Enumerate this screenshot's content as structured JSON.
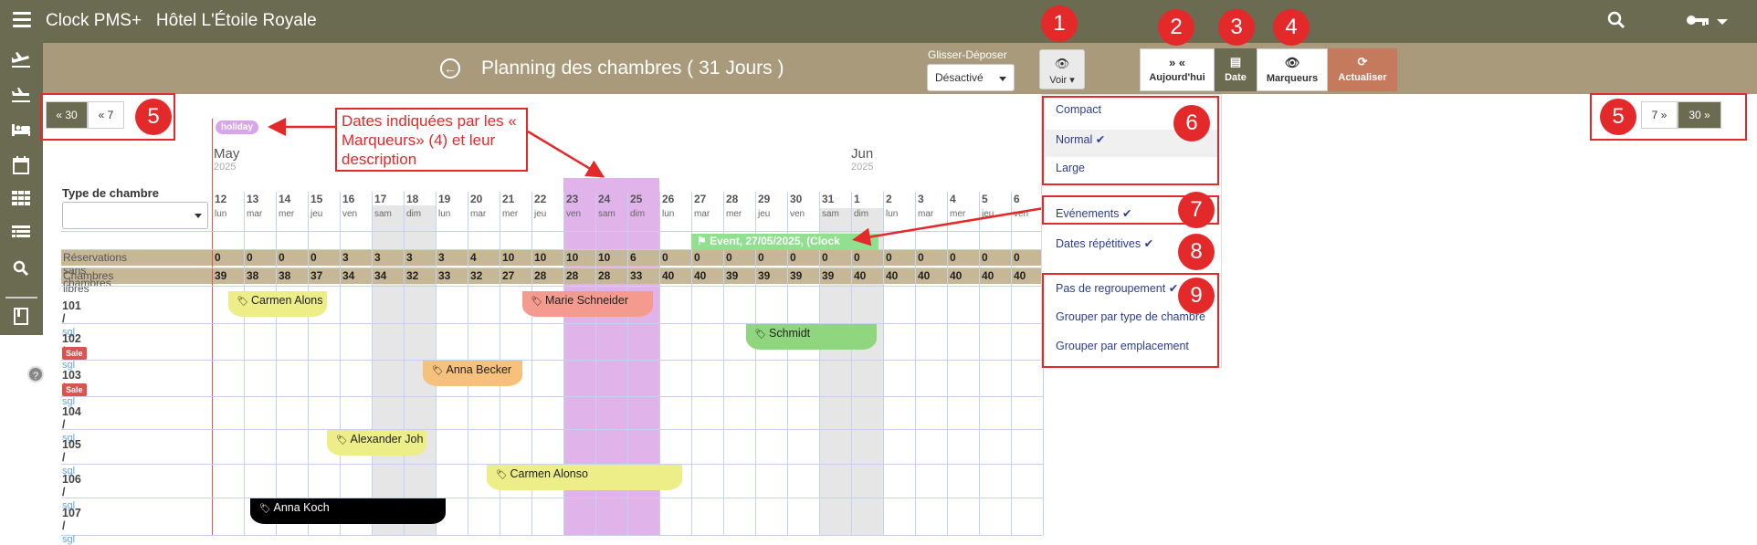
{
  "app": {
    "name": "Clock PMS+",
    "hotel": "Hôtel L'Étoile Royale"
  },
  "header": {
    "title": "Planning des chambres ( 31 Jours )"
  },
  "drag_drop": {
    "label": "Glisser-Déposer",
    "value": "Désactivé"
  },
  "toolbar": {
    "view_label": "Voir",
    "today_label": "Aujourd'hui",
    "date_label": "Date",
    "markers_label": "Marqueurs",
    "refresh_label": "Actualiser"
  },
  "nav": {
    "back30": "« 30",
    "back7": "« 7",
    "fwd7": "7 »",
    "fwd30": "30 »"
  },
  "annotations": {
    "n1": "1",
    "n2": "2",
    "n3": "3",
    "n4": "4",
    "n5a": "5",
    "n5b": "5",
    "n6": "6",
    "n7": "7",
    "n8": "8",
    "n9": "9",
    "callout": "Dates indiquées par les « Marqueurs» (4) et leur description"
  },
  "marker": {
    "holiday": "holiday"
  },
  "months": [
    {
      "name": "May",
      "year": "2025"
    },
    {
      "name": "Jun",
      "year": "2025"
    }
  ],
  "room_type": {
    "label": "Type de chambre",
    "value": ""
  },
  "days": [
    {
      "d": "12",
      "w": "lun"
    },
    {
      "d": "13",
      "w": "mar"
    },
    {
      "d": "14",
      "w": "mer"
    },
    {
      "d": "15",
      "w": "jeu"
    },
    {
      "d": "16",
      "w": "ven"
    },
    {
      "d": "17",
      "w": "sam"
    },
    {
      "d": "18",
      "w": "dim"
    },
    {
      "d": "19",
      "w": "lun"
    },
    {
      "d": "20",
      "w": "mar"
    },
    {
      "d": "21",
      "w": "mer"
    },
    {
      "d": "22",
      "w": "jeu"
    },
    {
      "d": "23",
      "w": "ven"
    },
    {
      "d": "24",
      "w": "sam"
    },
    {
      "d": "25",
      "w": "dim"
    },
    {
      "d": "26",
      "w": "lun"
    },
    {
      "d": "27",
      "w": "mar"
    },
    {
      "d": "28",
      "w": "mer"
    },
    {
      "d": "29",
      "w": "jeu"
    },
    {
      "d": "30",
      "w": "ven"
    },
    {
      "d": "31",
      "w": "sam"
    },
    {
      "d": "1",
      "w": "dim"
    },
    {
      "d": "2",
      "w": "lun"
    },
    {
      "d": "3",
      "w": "mar"
    },
    {
      "d": "4",
      "w": "mer"
    },
    {
      "d": "5",
      "w": "jeu"
    },
    {
      "d": "6",
      "w": "ven"
    }
  ],
  "weekend_days": [
    "17",
    "18",
    "24",
    "25",
    "31",
    "1"
  ],
  "holiday_days": [
    "23",
    "24",
    "25"
  ],
  "summary": {
    "unassigned_label": "Réservations sans chambres",
    "free_label": "Chambres libres",
    "unassigned": [
      "0",
      "0",
      "0",
      "0",
      "3",
      "3",
      "3",
      "3",
      "4",
      "10",
      "10",
      "10",
      "10",
      "6",
      "0",
      "0",
      "0",
      "0",
      "0",
      "0",
      "0",
      "0",
      "0",
      "0",
      "0",
      "0"
    ],
    "free": [
      "39",
      "38",
      "38",
      "37",
      "34",
      "34",
      "32",
      "33",
      "32",
      "27",
      "28",
      "28",
      "28",
      "33",
      "40",
      "40",
      "39",
      "39",
      "39",
      "39",
      "40",
      "40",
      "40",
      "40",
      "40",
      "40"
    ]
  },
  "event": {
    "text": "Event, 27/05/2025, (Clock"
  },
  "rooms": [
    {
      "num": "101",
      "type": "sgl",
      "sale": ""
    },
    {
      "num": "102",
      "type": "sgl",
      "sale": "Sale"
    },
    {
      "num": "103",
      "type": "sgl",
      "sale": "Sale"
    },
    {
      "num": "104",
      "type": "sgl",
      "sale": ""
    },
    {
      "num": "105",
      "type": "sgl",
      "sale": ""
    },
    {
      "num": "106",
      "type": "sgl",
      "sale": ""
    },
    {
      "num": "107",
      "type": "sgl",
      "sale": ""
    }
  ],
  "reservations": [
    {
      "name": "Carmen Alons",
      "color": "#eeee88"
    },
    {
      "name": "Marie Schneider",
      "color": "#f49a8e"
    },
    {
      "name": "Schmidt",
      "color": "#90d67e"
    },
    {
      "name": "Anna Becker",
      "color": "#f7c07d"
    },
    {
      "name": "Alexander Joh",
      "color": "#eeee88"
    },
    {
      "name": "Carmen Alonso",
      "color": "#eeee88"
    },
    {
      "name": "Anna Koch",
      "color": "#000000"
    }
  ],
  "view_menu": {
    "compact": "Compact",
    "normal": "Normal",
    "large": "Large",
    "events": "Evénements",
    "repeating": "Dates répétitives",
    "no_group": "Pas de regroupement",
    "group_type": "Grouper par type de chambre",
    "group_location": "Grouper par emplacement"
  },
  "colors": {
    "header": "#6b6b52",
    "titlebar": "#a89a7b",
    "refresh": "#c57a5e",
    "holiday": "#e0b4ea",
    "weekend": "#e6e6e6",
    "annotation": "#e3292a"
  }
}
